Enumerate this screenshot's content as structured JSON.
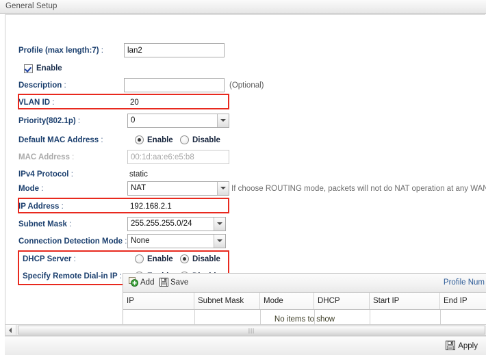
{
  "window": {
    "title": "General Setup"
  },
  "form": {
    "profile": {
      "label": "Profile (max length:7)",
      "colon": " :",
      "value": "lan2"
    },
    "enable": {
      "label": "Enable",
      "checked": true
    },
    "description": {
      "label": "Description",
      "colon": " :",
      "value": "",
      "placeholder": "",
      "optional_note": "(Optional)"
    },
    "vlan_id": {
      "label": "VLAN ID",
      "colon": " :",
      "value": "20",
      "highlighted": true
    },
    "priority": {
      "label": "Priority(802.1p)",
      "colon": " :",
      "value": "0"
    },
    "default_mac_address": {
      "label": "Default MAC Address",
      "colon": " :",
      "enable_label": "Enable",
      "disable_label": "Disable",
      "selected": "Enable"
    },
    "mac_address": {
      "label": "MAC Address",
      "colon": " :",
      "value": "00:1d:aa:e6:e5:b8",
      "disabled": true
    },
    "ipv4_protocol": {
      "label": "IPv4 Protocol",
      "colon": " :",
      "value": "static"
    },
    "mode": {
      "label": "Mode",
      "colon": " :",
      "value": "NAT",
      "hint": "If choose ROUTING mode, packets will not do NAT operation at any WAN side"
    },
    "ip_address": {
      "label": "IP Address",
      "colon": " :",
      "value": "192.168.2.1",
      "highlighted": true
    },
    "subnet_mask": {
      "label": "Subnet Mask",
      "colon": " :",
      "value": "255.255.255.0/24"
    },
    "connection_detection_mode": {
      "label": "Connection Detection Mode",
      "colon": " :",
      "value": "None"
    },
    "dhcp_server": {
      "label": "DHCP Server",
      "colon": " :",
      "enable_label": "Enable",
      "disable_label": "Disable",
      "selected": "Disable"
    },
    "specify_remote_dialin_ip": {
      "label": "Specify Remote Dial-in IP",
      "colon": " :",
      "enable_label": "Enable",
      "disable_label": "Disable",
      "selected": "Disable"
    }
  },
  "grid": {
    "toolbar": {
      "add_label": "Add",
      "add_icon": "add-green-plus-icon",
      "save_label": "Save",
      "save_icon": "floppy-disk-icon",
      "profile_num_label": "Profile Num"
    },
    "columns": [
      "IP",
      "Subnet Mask",
      "Mode",
      "DHCP",
      "Start IP",
      "End IP"
    ],
    "rows": [],
    "empty_message": "No items to show"
  },
  "scrollbar": {
    "left_arrow_icon": "left-arrow-icon",
    "grip_icon": "grip-dots-icon"
  },
  "footer": {
    "apply_label": "Apply",
    "apply_icon": "floppy-disk-icon"
  },
  "colors": {
    "highlight_red": "#e8291e",
    "label_blue": "#1b3f6e",
    "link_blue": "#2d5b96"
  }
}
